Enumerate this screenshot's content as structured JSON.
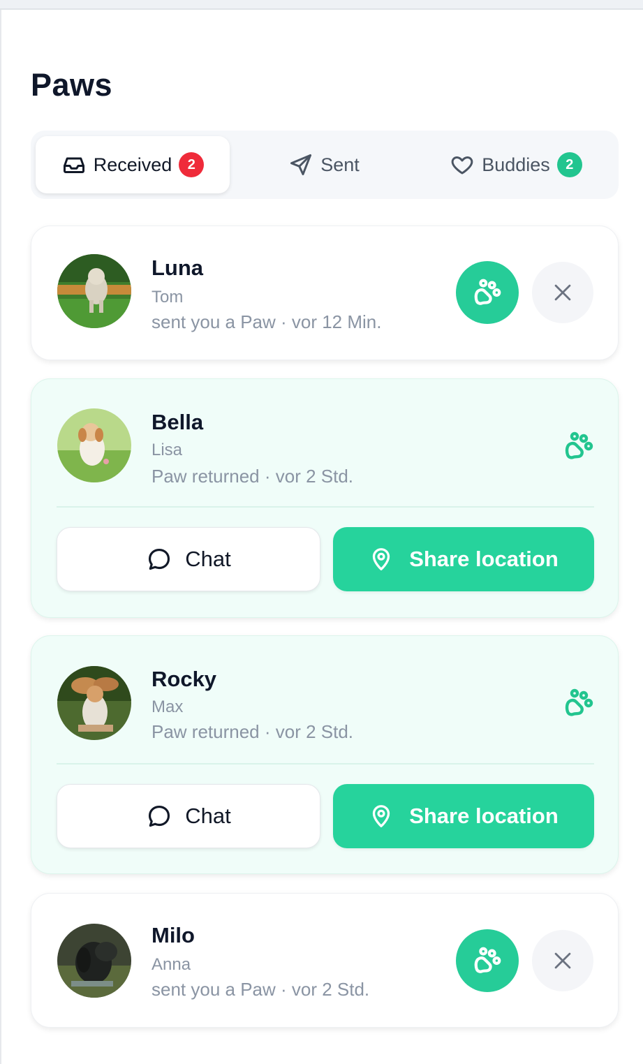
{
  "page": {
    "title": "Paws"
  },
  "tabs": [
    {
      "label": "Received",
      "badge": "2",
      "active": true,
      "icon": "inbox-icon"
    },
    {
      "label": "Sent",
      "active": false,
      "icon": "send-icon"
    },
    {
      "label": "Buddies",
      "badge": "2",
      "active": false,
      "icon": "heart-icon"
    }
  ],
  "paws": [
    {
      "dog": "Luna",
      "owner": "Tom",
      "status": "sent you a Paw · vor 12 Min.",
      "state": "incoming"
    },
    {
      "dog": "Bella",
      "owner": "Lisa",
      "status": "Paw returned · vor 2 Std.",
      "state": "matched",
      "chat_label": "Chat",
      "share_label": "Share location"
    },
    {
      "dog": "Rocky",
      "owner": "Max",
      "status": "Paw returned · vor 2 Std.",
      "state": "matched",
      "chat_label": "Chat",
      "share_label": "Share location"
    },
    {
      "dog": "Milo",
      "owner": "Anna",
      "status": "sent you a Paw · vor 2 Std.",
      "state": "incoming"
    }
  ],
  "colors": {
    "accent": "#26d39c",
    "badge_red": "#ef2b3a",
    "badge_green": "#22c58f",
    "matched_bg": "#f0fdf9"
  }
}
